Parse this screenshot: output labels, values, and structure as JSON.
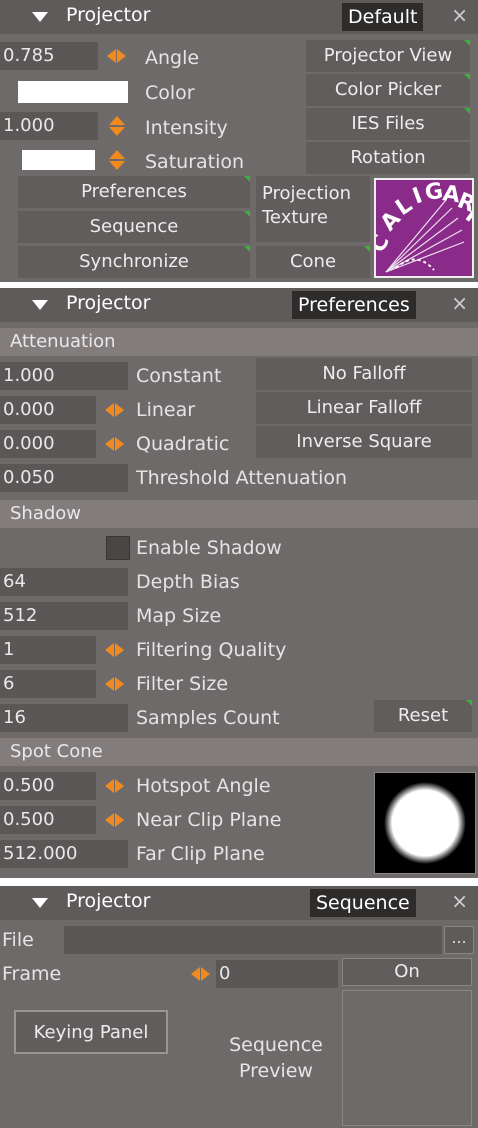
{
  "panels": {
    "default": {
      "title": "Projector",
      "tab": "Default",
      "close": "×",
      "rows": [
        {
          "value": "0.785",
          "label": "Angle"
        },
        {
          "value": "",
          "label": "Color"
        },
        {
          "value": "1.000",
          "label": "Intensity"
        },
        {
          "value": "",
          "label": "Saturation"
        }
      ],
      "right_buttons": [
        "Projector View",
        "Color Picker",
        "IES Files",
        "Rotation"
      ],
      "left_buttons": [
        "Preferences",
        "Sequence",
        "Synchronize"
      ],
      "projection_texture": "Projection\nTexture",
      "projection_texture_line1": "Projection",
      "projection_texture_line2": "Texture",
      "cone": "Cone",
      "logo_text": "CALIGARI"
    },
    "preferences": {
      "title": "Projector",
      "tab": "Preferences",
      "close": "×",
      "attenuation": {
        "header": "Attenuation",
        "rows": [
          {
            "value": "1.000",
            "label": "Constant"
          },
          {
            "value": "0.000",
            "label": "Linear"
          },
          {
            "value": "0.000",
            "label": "Quadratic"
          },
          {
            "value": "0.050",
            "label": "Threshold Attenuation"
          }
        ],
        "buttons": [
          "No Falloff",
          "Linear Falloff",
          "Inverse Square"
        ]
      },
      "shadow": {
        "header": "Shadow",
        "enable_label": "Enable Shadow",
        "rows": [
          {
            "value": "64",
            "label": "Depth Bias"
          },
          {
            "value": "512",
            "label": "Map Size"
          },
          {
            "value": "1",
            "label": "Filtering Quality"
          },
          {
            "value": "6",
            "label": "Filter Size"
          },
          {
            "value": "16",
            "label": "Samples Count"
          }
        ],
        "reset": "Reset"
      },
      "spot_cone": {
        "header": "Spot Cone",
        "rows": [
          {
            "value": "0.500",
            "label": "Hotspot Angle"
          },
          {
            "value": "0.500",
            "label": "Near Clip Plane"
          },
          {
            "value": "512.000",
            "label": "Far Clip Plane"
          }
        ]
      }
    },
    "sequence": {
      "title": "Projector",
      "tab": "Sequence",
      "close": "×",
      "file_label": "File",
      "file_value": "",
      "browse": "...",
      "frame_label": "Frame",
      "frame_value": "0",
      "on_button": "On",
      "keying_panel": "Keying Panel",
      "preview_line1": "Sequence",
      "preview_line2": "Preview"
    }
  },
  "colors": {
    "accent_orange": "#f08a1e",
    "corner_green": "#39b439",
    "panel_bg": "#6e6a6a",
    "logo_purple": "#8a2b8a"
  }
}
